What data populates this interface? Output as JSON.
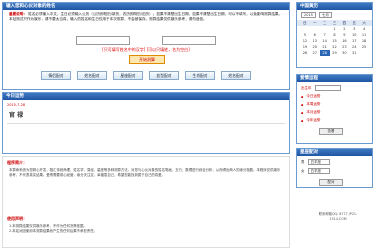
{
  "input_panel": {
    "title": "输入您和心仪对象的姓名",
    "intro_prefix": "重要说明：",
    "intro_text": "姓名必须输入中文，生日必须输入公历（公历即阳历/新历，农历即阴历/旧历）；如果不清楚出生日期，如果不清楚出生日期，可以不填写，以免影响测算结果。本站测试只作为娱乐，请不要太当真，输入的姓名和生日仅用于本次测算，不会被保存。测算结果仅供娱乐参考，请勿迷信。",
    "name_placeholder": "",
    "hint": "[只可填写姓名中的汉字] [可以只填姓，名为空白]",
    "start_label": "开始测算",
    "functions": [
      "情侣配对",
      "姓名配对",
      "星座配对",
      "血型配对",
      "生肖配对",
      "姓名配对"
    ]
  },
  "today": {
    "title": "今日运势",
    "date": "2015-7-28",
    "word": "官 禄"
  },
  "explain": {
    "title": "程序简介：",
    "body": "本算命系统为您精心开发，融汇传统命理、姓名学、易经、星座等多种测算方法，对您与心仪对象的姓名笔画、五行、数理进行综合分析，从而得出两人的缘分指数。本程序仅供娱乐参考，不代表真实结果。爱情需要用心经营，缘分天注定，幸福靠自己。希望您能找到属于自己的真爱。",
    "section2_title": "使用声明：",
    "section2_body": "1.本测算结果仅供娱乐参考，不作为任何决策依据。",
    "section2_body2": "2.本站对因使用本测算结果而产生的任何后果不承担责任。"
  },
  "calendar": {
    "title": "中国黄历",
    "year": "2015",
    "month": "七月",
    "weekdays": [
      "日",
      "一",
      "二",
      "三",
      "四",
      "五",
      "六"
    ],
    "weeks": [
      [
        "",
        "",
        "",
        "1",
        "2",
        "3",
        "4"
      ],
      [
        "5",
        "6",
        "7",
        "8",
        "9",
        "10",
        "11"
      ],
      [
        "12",
        "13",
        "14",
        "15",
        "16",
        "17",
        "18"
      ],
      [
        "19",
        "20",
        "21",
        "22",
        "23",
        "24",
        "25"
      ],
      [
        "26",
        "27",
        "28",
        "29",
        "30",
        "31",
        ""
      ]
    ],
    "today": "28"
  },
  "love": {
    "title": "爱情运程",
    "label": "出生年",
    "rows": [
      {
        "label": "▪",
        "value": "今日运势"
      },
      {
        "label": "▪",
        "value": "本周运势"
      },
      {
        "label": "▪",
        "value": "本月运势"
      },
      {
        "label": "▪",
        "value": "今年运势"
      }
    ],
    "button": "查看"
  },
  "match": {
    "title": "星座配对",
    "rows": [
      {
        "label": "男",
        "value": "白羊座"
      },
      {
        "label": "女",
        "value": "白羊座"
      }
    ],
    "button": "配对"
  },
  "contact": {
    "line1": "联系邮箱QQ: 8777 /P21-",
    "line2": "1314.COM"
  }
}
